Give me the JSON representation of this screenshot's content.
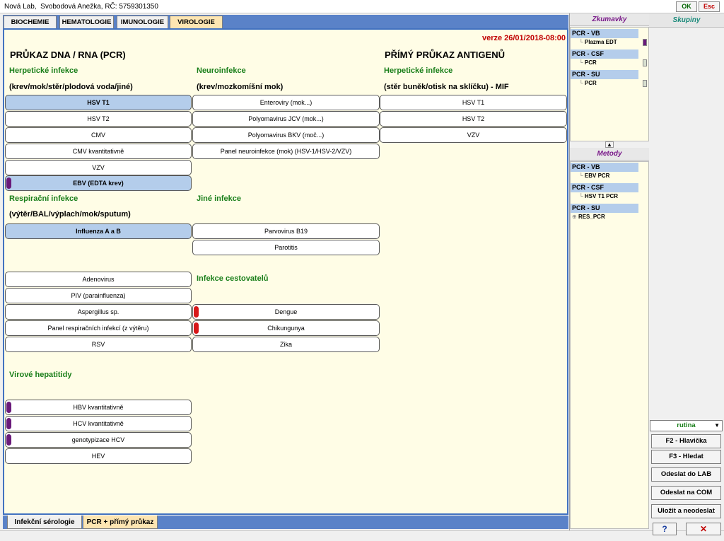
{
  "titlebar": {
    "title": "Nová Lab,  Svobodová Anežka, RČ: 5759301350",
    "ok": "OK",
    "esc": "Esc"
  },
  "tabs": [
    "BIOCHEMIE",
    "HEMATOLOGIE",
    "IMUNOLOGIE",
    "VIROLOGIE"
  ],
  "active_tab": "VIROLOGIE",
  "version": "verze 26/01/2018-08:00",
  "headers": {
    "pcr": "PRŮKAZ DNA / RNA (PCR)",
    "antigen": "PŘÍMÝ PRŮKAZ ANTIGENŮ"
  },
  "groups": {
    "herp": {
      "title": "Herpetické infekce",
      "sub": "(krev/mok/stěr/plodová voda/jiné)"
    },
    "neuro": {
      "title": "Neuroinfekce",
      "sub": "(krev/mozkomíšní mok)"
    },
    "herp2": {
      "title": "Herpetické infekce",
      "sub": "(stěr buněk/otisk na sklíčku) - MIF"
    },
    "resp": {
      "title": "Respirační infekce",
      "sub": "(výtěr/BAL/výplach/mok/sputum)"
    },
    "other": {
      "title": "Jiné infekce"
    },
    "travel": {
      "title": "Infekce cestovatelů"
    },
    "hep": {
      "title": "Virové hepatitidy"
    }
  },
  "buttons": {
    "hsv1": "HSV T1",
    "hsv2": "HSV T2",
    "cmv": "CMV",
    "cmv_q": "CMV kvantitativně",
    "vzv": "VZV",
    "ebv": "EBV (EDTA krev)",
    "enter": "Enteroviry (mok...)",
    "jcv": "Polyomavirus JCV (mok...)",
    "bkv": "Polyomavirus BKV (moč...)",
    "panel_neuro": "Panel neuroinfekce (mok) (HSV-1/HSV-2/VZV)",
    "mif_hsv1": "HSV T1",
    "mif_hsv2": "HSV T2",
    "mif_vzv": "VZV",
    "flu": "Influenza A a B",
    "adeno": "Adenovirus",
    "piv": "PIV (parainfluenza)",
    "asperg": "Aspergillus sp.",
    "panel_resp": "Panel respiračních infekcí (z výtěru)",
    "rsv": "RSV",
    "parvo": "Parvovirus B19",
    "parot": "Parotitis",
    "dengue": "Dengue",
    "chik": "Chikungunya",
    "zika": "Zika",
    "hbv": "HBV kvantitativně",
    "hcv": "HCV kvantitativně",
    "geno": "genotypizace HCV",
    "hev": "HEV"
  },
  "bottom_tabs": [
    "Infekční sérologie",
    "PCR + přímý průkaz"
  ],
  "active_bottom_tab": "PCR + přímý průkaz",
  "zkumavky": {
    "title": "Zkumavky",
    "groups": [
      {
        "name": "PCR - VB",
        "item": "Plazma EDT"
      },
      {
        "name": "PCR - CSF",
        "item": "PCR"
      },
      {
        "name": "PCR - SU",
        "item": "PCR"
      }
    ]
  },
  "metody": {
    "title": "Metody",
    "groups": [
      {
        "name": "PCR - VB",
        "item": "EBV PCR"
      },
      {
        "name": "PCR - CSF",
        "item": "HSV T1 PCR"
      },
      {
        "name": "PCR - SU",
        "item": "RES_PCR"
      }
    ]
  },
  "skupiny": "Skupiny",
  "mode_select": "rutina",
  "actions": {
    "f2": "F2 - Hlavička",
    "f3": "F3 - Hledat",
    "send_lab": "Odeslat do LAB",
    "send_com": "Odeslat na COM",
    "save": "Uložit a neodeslat",
    "help": "?",
    "close": "✕"
  },
  "colors": {
    "accent_blue": "#4272c0",
    "selected": "#b4cdeb",
    "panel_bg": "#fffde6",
    "group_green": "#1a7f1a",
    "version_red": "#c00000",
    "mark_purple": "#6a1a7a",
    "mark_red": "#d81818"
  }
}
